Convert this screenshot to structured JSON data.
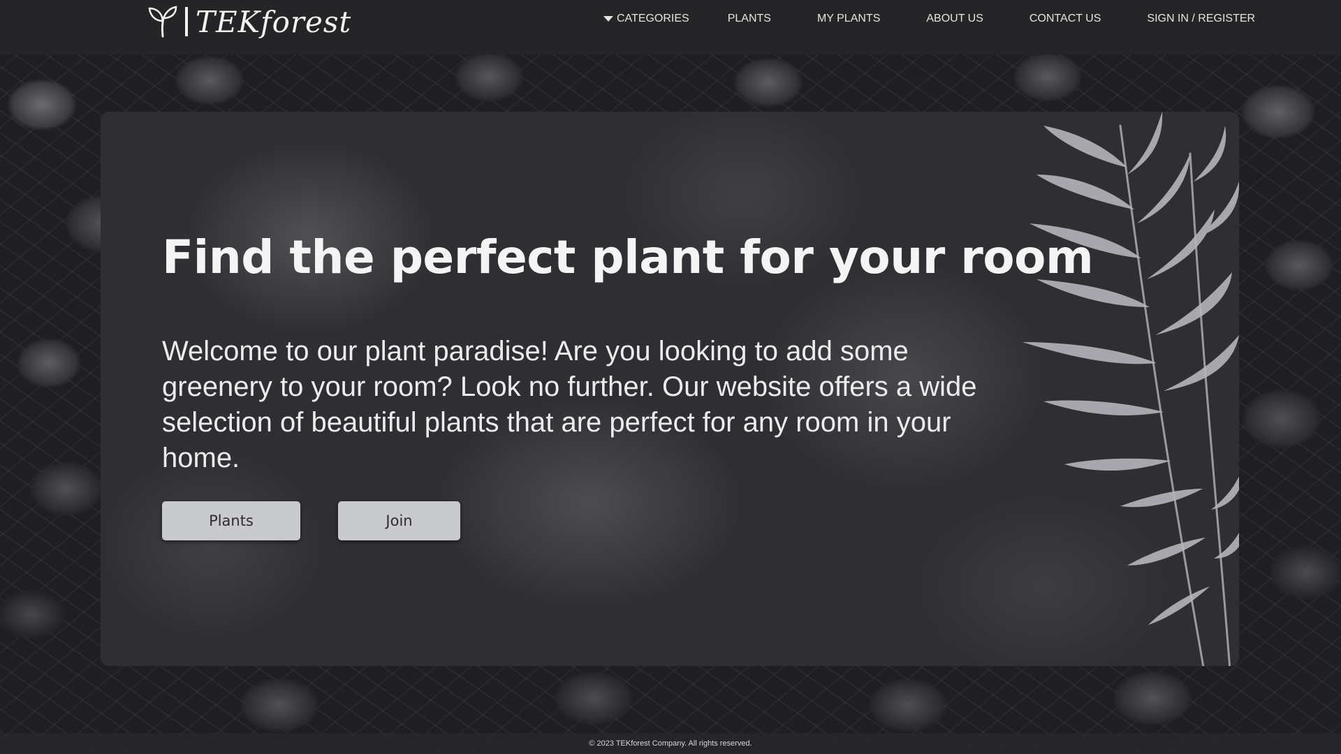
{
  "brand": {
    "name": "TEKforest",
    "logo_icon": "sprout-icon"
  },
  "nav": {
    "items": [
      {
        "label": "CATEGORIES",
        "icon": "caret-down-icon"
      },
      {
        "label": "PLANTS"
      },
      {
        "label": "MY PLANTS"
      },
      {
        "label": "ABOUT US"
      },
      {
        "label": "CONTACT US"
      },
      {
        "label": "SIGN IN / REGISTER"
      }
    ]
  },
  "hero": {
    "title": "Find the perfect plant for your room",
    "description": "Welcome to our plant paradise! Are you looking to add some greenery to your room? Look no further. Our website offers a wide selection of beautiful plants that are perfect for any room in your home.",
    "buttons": {
      "plants": "Plants",
      "join": "Join"
    }
  },
  "footer": {
    "copyright": "© 2023 TEKforest Company. All rights reserved."
  },
  "colors": {
    "header_bg": "#252528",
    "button_bg": "#c9cacd",
    "text": "#ececec"
  }
}
